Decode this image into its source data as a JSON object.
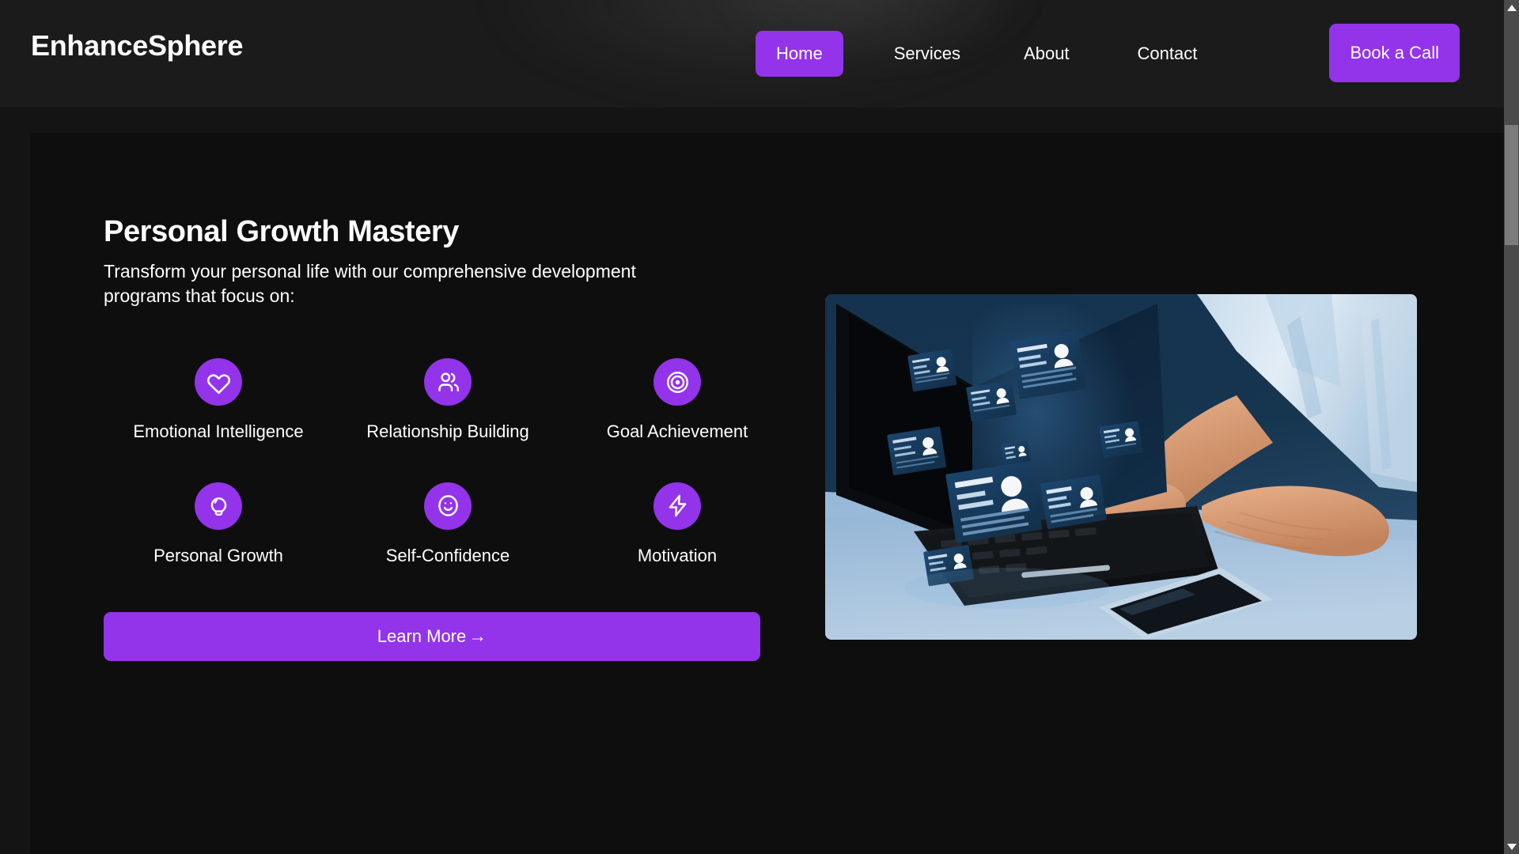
{
  "theme": {
    "accent": "#9333ea",
    "page_bg": "#121212",
    "header_bg": "#1b1b1b",
    "card_bg": "#0e0e0e",
    "text": "#ffffff"
  },
  "header": {
    "brand": "EnhanceSphere",
    "nav": [
      {
        "label": "Home",
        "active": true
      },
      {
        "label": "Services",
        "active": false
      },
      {
        "label": "About",
        "active": false
      },
      {
        "label": "Contact",
        "active": false
      }
    ],
    "cta_label": "Book a Call"
  },
  "hero": {
    "title": "Personal Growth Mastery",
    "subtitle": "Transform your personal life with our comprehensive development programs that focus on:",
    "features": [
      {
        "label": "Emotional Intelligence",
        "icon": "heart-icon"
      },
      {
        "label": "Relationship Building",
        "icon": "users-icon"
      },
      {
        "label": "Goal Achievement",
        "icon": "target-icon"
      },
      {
        "label": "Personal Growth",
        "icon": "lightbulb-icon"
      },
      {
        "label": "Self-Confidence",
        "icon": "smiley-icon"
      },
      {
        "label": "Motivation",
        "icon": "lightning-bolt-icon"
      }
    ],
    "cta_label": "Learn More",
    "cta_arrow": "→",
    "media_alt": "person typing on a laptop with floating profile cards"
  },
  "scrollbar": {
    "up_arrow": "scroll-up-arrow",
    "down_arrow": "scroll-down-arrow"
  }
}
